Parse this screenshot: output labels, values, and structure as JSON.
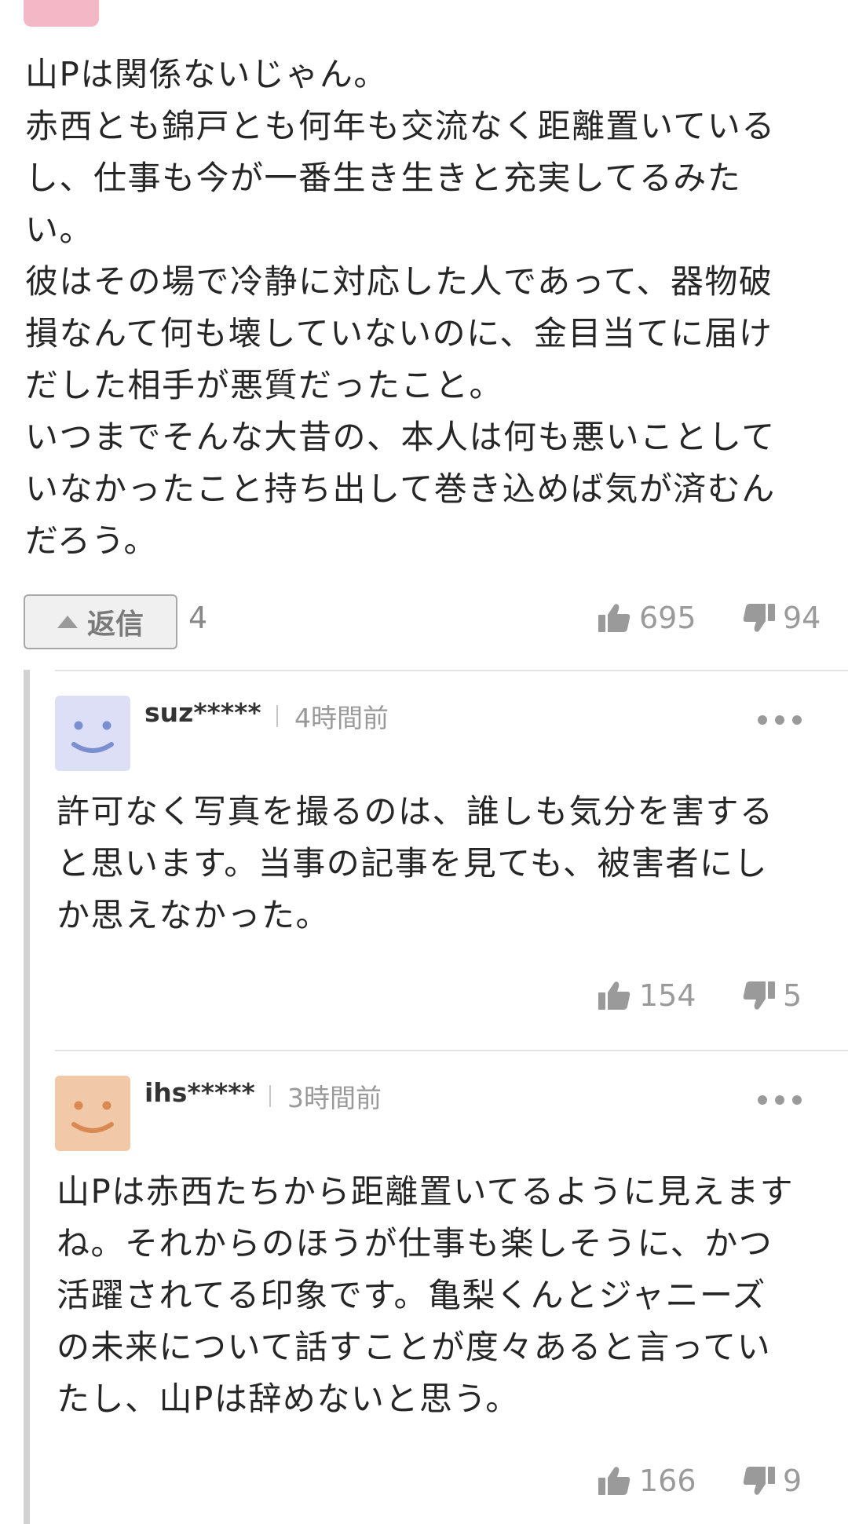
{
  "main_comment": {
    "lines": [
      "山Pは関係ないじゃん。",
      "赤西とも錦戸とも何年も交流なく距離置いている",
      "し、仕事も今が一番生き生きと充実してるみた",
      "い。",
      "彼はその場で冷静に対応した人であって、器物破",
      "損なんて何も壊していないのに、金目当てに届け",
      "だした相手が悪質だったこと。",
      "いつまでそんな大昔の、本人は何も悪いことして",
      "いなかったこと持ち出して巻き込めば気が済むん",
      "だろう。"
    ],
    "reply_label": "返信",
    "reply_count": "4",
    "likes": "695",
    "dislikes": "94"
  },
  "replies": [
    {
      "username": "suz*****",
      "time": "4時間前",
      "avatar_color": "#dcdff5",
      "avatar_feature_color": "#7b8fd0",
      "lines": [
        "許可なく写真を撮るのは、誰しも気分を害する",
        "と思います。当事の記事を見ても、被害者にし",
        "か思えなかった。"
      ],
      "likes": "154",
      "dislikes": "5"
    },
    {
      "username": "ihs*****",
      "time": "3時間前",
      "avatar_color": "#f2c9a8",
      "avatar_feature_color": "#d98a52",
      "lines": [
        "山Pは赤西たちから距離置いてるように見えます",
        "ね。それからのほうが仕事も楽しそうに、かつ",
        "活躍されてる印象です。亀梨くんとジャニーズ",
        "の未来について話すことが度々あると言ってい",
        "たし、山Pは辞めないと思う。"
      ],
      "likes": "166",
      "dislikes": "9"
    }
  ],
  "icons": {
    "like": "thumbs-up-icon",
    "dislike": "thumbs-down-icon",
    "more": "more-options-icon",
    "reply_arrow": "triangle-up-icon"
  }
}
